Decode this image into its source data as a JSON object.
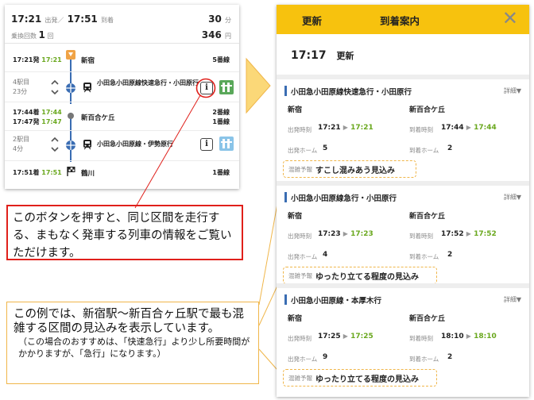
{
  "route": {
    "summary": {
      "dep_time": "17:21",
      "dep_label": "出発",
      "arr_time": "17:51",
      "arr_label": "到着",
      "duration": "30",
      "duration_unit": "分",
      "transfer_label": "乗換回数",
      "transfers": "1",
      "transfers_unit": "回",
      "fare": "346",
      "fare_unit": "円"
    },
    "rows": {
      "shinjuku_time": "17:21発",
      "shinjuku_time_g": "17:21",
      "shinjuku_name": "新宿",
      "shinjuku_plat": "5番線",
      "leg1_stops": "4駅目",
      "leg1_mins": "23分",
      "leg1_train": "小田急小田原線快速急行・小田原行",
      "mid_arr": "17:44着",
      "mid_arr_g": "17:44",
      "mid_dep": "17:47発",
      "mid_dep_g": "17:47",
      "mid_name": "新百合ケ丘",
      "mid_plat1": "2番線",
      "mid_plat2": "1番線",
      "leg2_stops": "2駅目",
      "leg2_mins": "4分",
      "leg2_train": "小田急小田原線・伊勢原行",
      "dest_time": "17:51着",
      "dest_time_g": "17:51",
      "dest_name": "鶴川",
      "dest_plat": "1番線"
    }
  },
  "callouts": {
    "button_note": "このボタンを押すと、同じ区間を走行する、まもなく発車する列車の情報をご覧いただけます。",
    "example_note": "この例では、新宿駅～新百合ヶ丘駅で最も混雑する区間の見込みを表示しています。",
    "example_sub": "（この場合のおすすめは、「快速急行」より少し所要時間がかかりますが、「急行」になります。）"
  },
  "panel": {
    "update_button": "更新",
    "title": "到着案内",
    "close_icon": "close-icon",
    "time": "17:17",
    "time_update": "更新",
    "labels": {
      "detail": "詳細▼",
      "dep_time": "出発時刻",
      "arr_time": "到着時刻",
      "dep_platform": "出発ホーム",
      "arr_platform": "到着ホーム",
      "crowd": "混雑予報"
    },
    "cards": [
      {
        "train": "小田急小田原線快速急行・小田原行",
        "from": "新宿",
        "to": "新百合ケ丘",
        "dep_sched": "17:21",
        "dep_real": "17:21",
        "arr_sched": "17:44",
        "arr_real": "17:44",
        "dep_platform": "5",
        "arr_platform": "2",
        "crowd": "すこし混みあう見込み"
      },
      {
        "train": "小田急小田原線急行・小田原行",
        "from": "新宿",
        "to": "新百合ケ丘",
        "dep_sched": "17:23",
        "dep_real": "17:23",
        "arr_sched": "17:52",
        "arr_real": "17:52",
        "dep_platform": "4",
        "arr_platform": "2",
        "crowd": "ゆったり立てる程度の見込み"
      },
      {
        "train": "小田急小田原線・本厚木行",
        "from": "新宿",
        "to": "新百合ケ丘",
        "dep_sched": "17:25",
        "dep_real": "17:25",
        "arr_sched": "18:10",
        "arr_real": "18:10",
        "dep_platform": "9",
        "arr_platform": "2",
        "crowd": "ゆったり立てる程度の見込み"
      }
    ]
  },
  "colors": {
    "accent_yellow": "#f7c20e",
    "line_blue": "#3a6db3",
    "realtime_green": "#6aa81e",
    "callout_red": "#e0201b",
    "callout_orange": "#f0b64a"
  }
}
